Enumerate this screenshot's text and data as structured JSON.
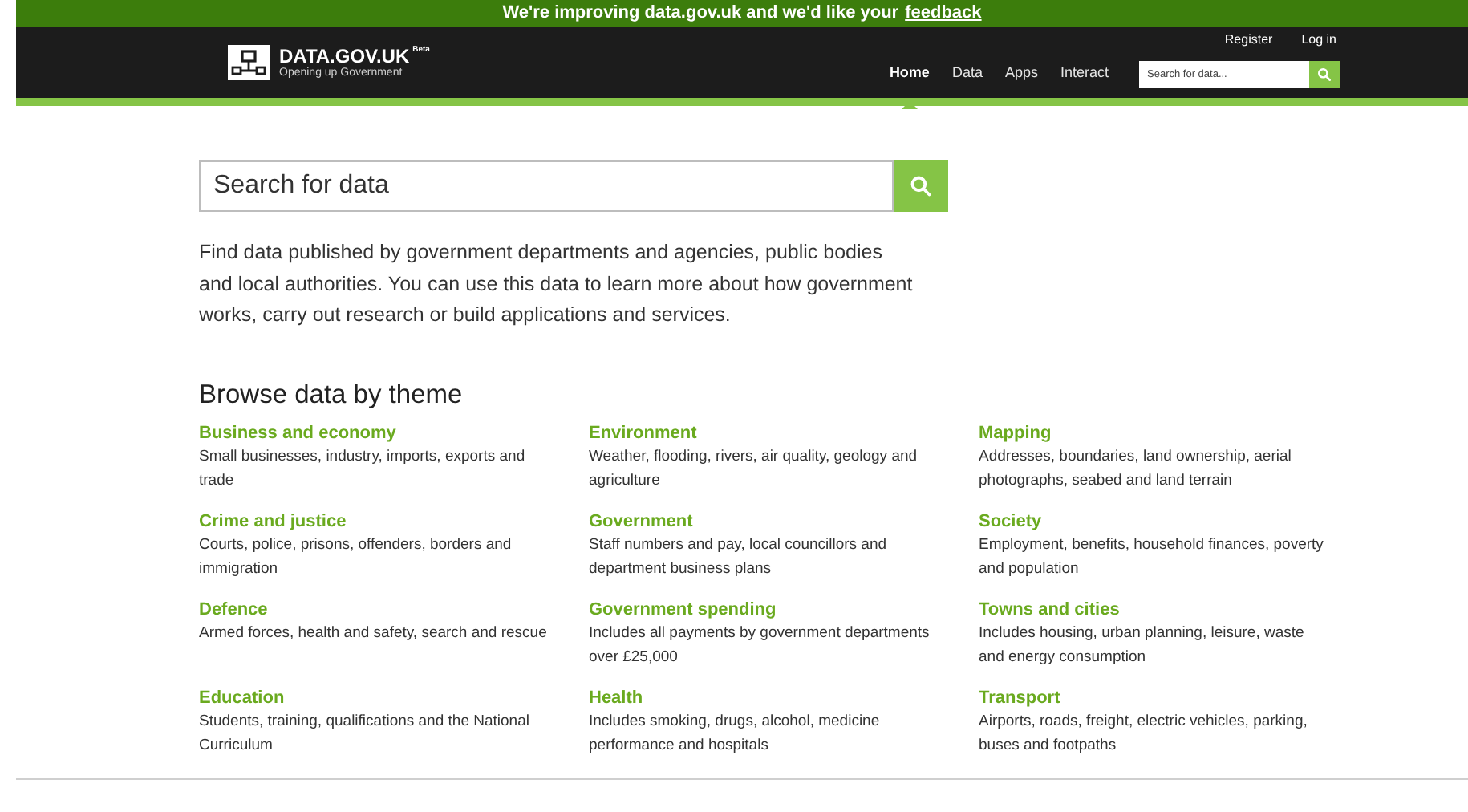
{
  "banner": {
    "text": "We're improving data.gov.uk and we'd like your",
    "link": "feedback"
  },
  "header": {
    "logo": "DATA.GOV.UK",
    "badge": "Beta",
    "tagline": "Opening up Government",
    "account_links": [
      "Register",
      "Log in"
    ],
    "nav": [
      {
        "label": "Home",
        "selected": true
      },
      {
        "label": "Data",
        "selected": false
      },
      {
        "label": "Apps",
        "selected": false
      },
      {
        "label": "Interact",
        "selected": false
      }
    ],
    "search": {
      "placeholder": "Search for data..."
    }
  },
  "search": {
    "placeholder": "Search for data"
  },
  "intro": "Find data published by government departments and agencies, public bodies and local authorities. You can use this data to learn more about how government works, carry out research or build applications and services.",
  "themes_title": "Browse data by theme",
  "themes": [
    {
      "title": "Business and economy",
      "description": "Small businesses, industry, imports, exports and trade"
    },
    {
      "title": "Environment",
      "description": "Weather, flooding, rivers, air quality, geology and agriculture"
    },
    {
      "title": "Mapping",
      "description": "Addresses, boundaries, land ownership, aerial photographs, seabed and land terrain"
    },
    {
      "title": "Crime and justice",
      "description": "Courts, police, prisons, offenders, borders and immigration"
    },
    {
      "title": "Government",
      "description": "Staff numbers and pay, local councillors and department business plans"
    },
    {
      "title": "Society",
      "description": "Employment, benefits, household finances, poverty and population"
    },
    {
      "title": "Defence",
      "description": "Armed forces, health and safety, search and rescue"
    },
    {
      "title": "Government spending",
      "description": "Includes all payments by government departments over £25,000"
    },
    {
      "title": "Towns and cities",
      "description": "Includes housing, urban planning, leisure, waste and energy consumption"
    },
    {
      "title": "Education",
      "description": "Students, training, qualifications and the National Curriculum"
    },
    {
      "title": "Health",
      "description": "Includes smoking, drugs, alcohol, medicine performance and hospitals"
    },
    {
      "title": "Transport",
      "description": "Airports, roads, freight, electric vehicles, parking, buses and footpaths"
    }
  ]
}
